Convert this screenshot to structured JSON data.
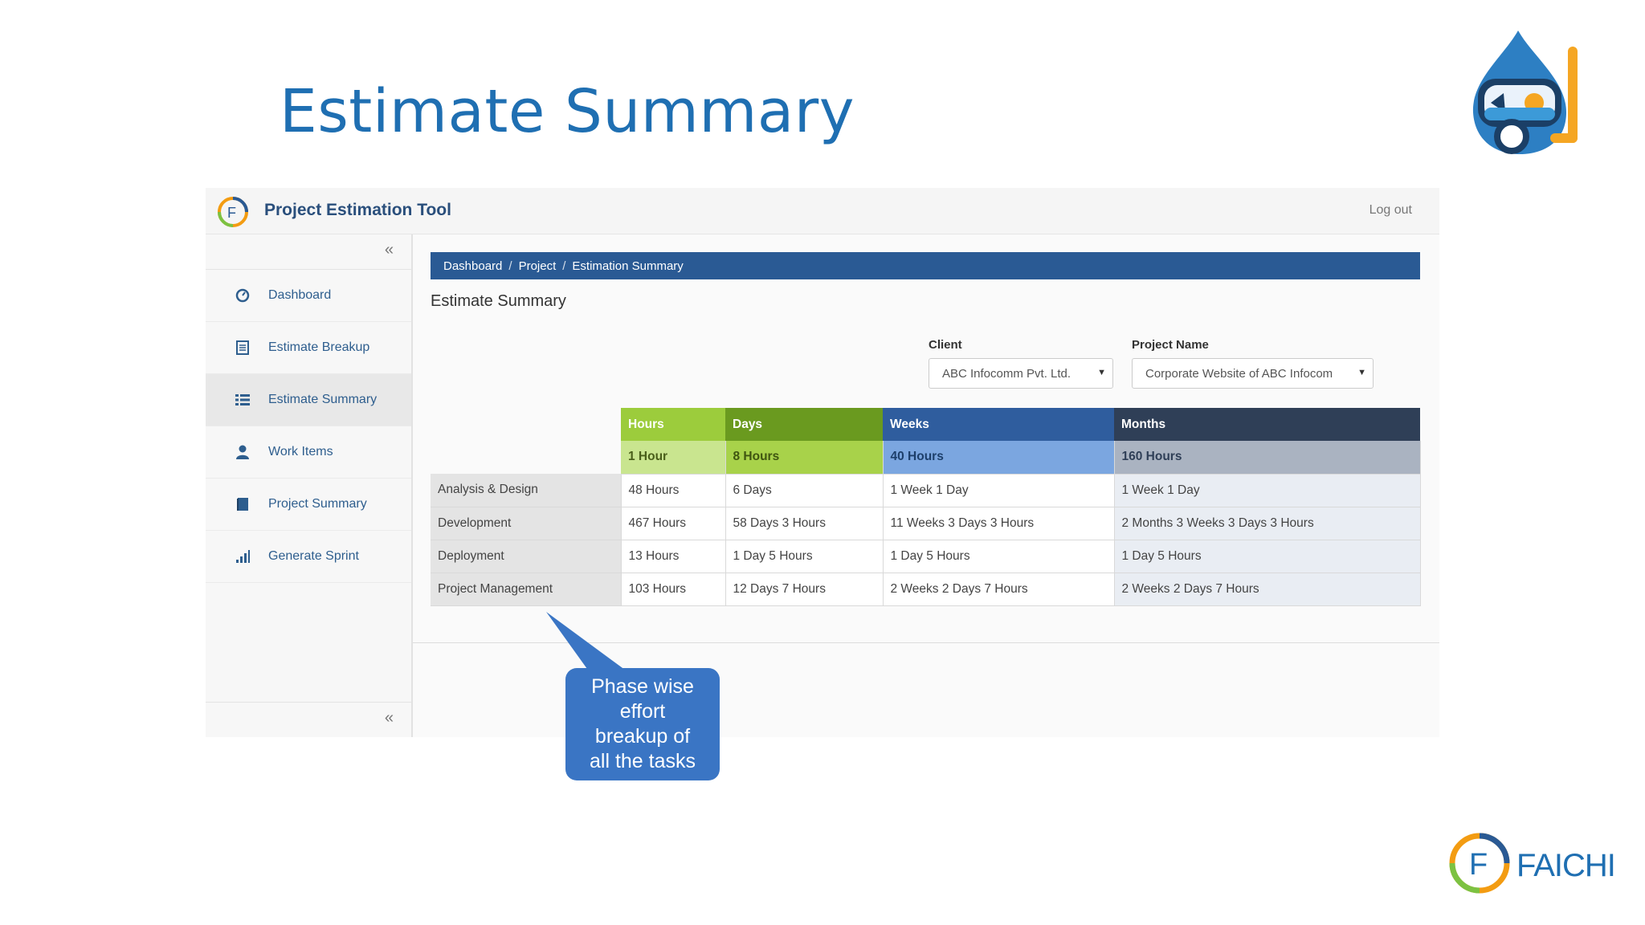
{
  "slide": {
    "title": "Estimate Summary",
    "brand": "FAICHI"
  },
  "app": {
    "title": "Project Estimation Tool",
    "logout": "Log out",
    "collapse_glyph": "«"
  },
  "sidebar": {
    "items": [
      {
        "label": "Dashboard",
        "icon": "dashboard-icon",
        "active": false
      },
      {
        "label": "Estimate Breakup",
        "icon": "document-icon",
        "active": false
      },
      {
        "label": "Estimate Summary",
        "icon": "list-icon",
        "active": true
      },
      {
        "label": "Work Items",
        "icon": "user-icon",
        "active": false
      },
      {
        "label": "Project Summary",
        "icon": "book-icon",
        "active": false
      },
      {
        "label": "Generate Sprint",
        "icon": "bar-chart-icon",
        "active": false
      }
    ]
  },
  "breadcrumb": [
    "Dashboard",
    "Project",
    "Estimation Summary"
  ],
  "breadcrumb_sep": "/",
  "page": {
    "heading": "Estimate Summary"
  },
  "filters": {
    "client_label": "Client",
    "client_value": "ABC Infocomm Pvt. Ltd.",
    "project_label": "Project Name",
    "project_value": "Corporate Website of ABC Infocom"
  },
  "table": {
    "headers": [
      "Hours",
      "Days",
      "Weeks",
      "Months"
    ],
    "units": [
      "1 Hour",
      "8 Hours",
      "40 Hours",
      "160 Hours"
    ],
    "rows": [
      {
        "label": "Analysis & Design",
        "values": [
          "48 Hours",
          "6 Days",
          "1 Week 1 Day",
          "1 Week 1 Day"
        ]
      },
      {
        "label": "Development",
        "values": [
          "467 Hours",
          "58 Days 3 Hours",
          "11 Weeks 3 Days 3 Hours",
          "2 Months 3 Weeks 3 Days 3 Hours"
        ]
      },
      {
        "label": "Deployment",
        "values": [
          "13 Hours",
          "1 Day 5 Hours",
          "1 Day 5 Hours",
          "1 Day 5 Hours"
        ]
      },
      {
        "label": "Project Management",
        "values": [
          "103 Hours",
          "12 Days 7 Hours",
          "2 Weeks 2 Days 7 Hours",
          "2 Weeks 2 Days 7 Hours"
        ]
      }
    ]
  },
  "colors": {
    "hours_header": "#9ccc3c",
    "hours_sub": "#c9e58f",
    "days_header": "#6a9a1f",
    "days_sub": "#a8d24a",
    "weeks_header": "#2f5d9e",
    "weeks_sub": "#7ba6e0",
    "months_header": "#2f3f57",
    "months_sub": "#aab3c1",
    "callout": "#3a75c4"
  },
  "callout": {
    "lines": [
      "Phase wise",
      "effort",
      "breakup of",
      "all the tasks"
    ]
  }
}
